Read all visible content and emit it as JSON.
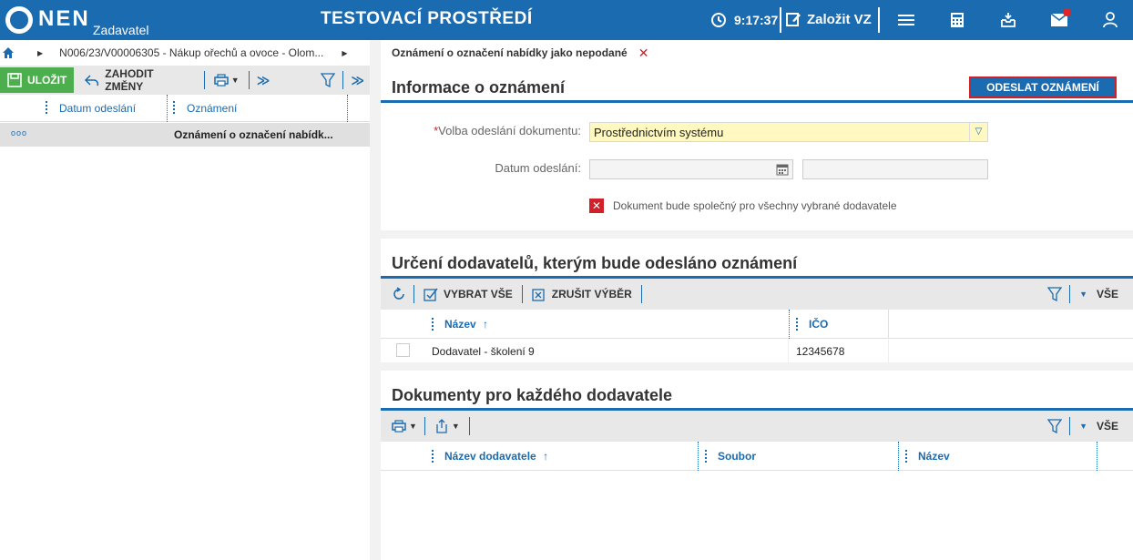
{
  "header": {
    "logo": "NEN",
    "logo_sub": "Zadavatel",
    "env_title": "TESTOVACÍ PROSTŘEDÍ",
    "time": "9:17:37",
    "new_vz": "Založit VZ",
    "icons": [
      "clock-icon",
      "edit-icon",
      "menu-icon",
      "calculator-icon",
      "inbox-icon",
      "mail-icon",
      "user-icon"
    ]
  },
  "left": {
    "breadcrumb": "N006/23/V00006305 - Nákup ořechů a ovoce - Olom...",
    "toolbar": {
      "save": "ULOŽIT",
      "discard": "ZAHODIT ZMĚNY"
    },
    "grid": {
      "columns": [
        "Datum odeslání",
        "Oznámení"
      ],
      "rows": [
        {
          "marker": "ooo",
          "date": "",
          "notice": "Oznámení o označení nabídk..."
        }
      ]
    }
  },
  "right": {
    "breadcrumb": "Oznámení o označení nabídky jako nepodané",
    "info": {
      "title": "Informace o oznámení",
      "send_button": "ODESLAT OZNÁMENÍ",
      "required_mark": "*",
      "send_label": "Volba odeslání dokumentu:",
      "send_value": "Prostřednictvím systému",
      "date_label": "Datum odeslání:",
      "common_doc_label": "Dokument bude společný pro všechny vybrané dodavatele"
    },
    "suppliers": {
      "title": "Určení dodavatelů, kterým bude odesláno oznámení",
      "select_all": "VYBRAT VŠE",
      "deselect": "ZRUŠIT VÝBĚR",
      "filter_all": "VŠE",
      "columns": [
        "Název",
        "IČO"
      ],
      "rows": [
        {
          "name": "Dodavatel - školení 9",
          "ico": "12345678"
        }
      ]
    },
    "documents": {
      "title": "Dokumenty pro každého dodavatele",
      "filter_all": "VŠE",
      "columns": [
        "Název dodavatele",
        "Soubor",
        "Název"
      ]
    }
  },
  "colors": {
    "primary": "#1a6bb0",
    "save_green": "#4cae4c",
    "danger": "#d0202a",
    "highlight": "#fff8c0"
  }
}
